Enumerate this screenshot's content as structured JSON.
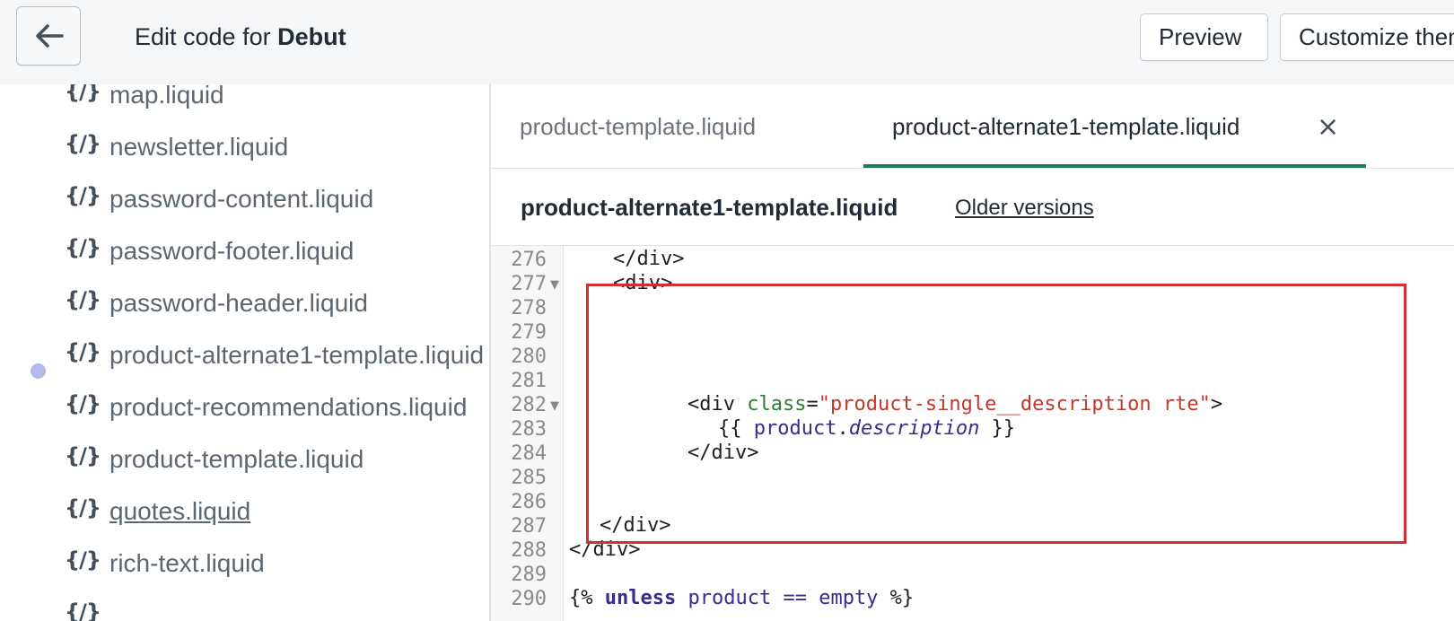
{
  "header": {
    "title_prefix": "Edit code for ",
    "theme_name": "Debut",
    "preview_label": "Preview",
    "customize_label": "Customize theme"
  },
  "sidebar": {
    "icon_glyph": "{/}",
    "items": [
      {
        "label": "map.liquid"
      },
      {
        "label": "newsletter.liquid"
      },
      {
        "label": "password-content.liquid"
      },
      {
        "label": "password-footer.liquid"
      },
      {
        "label": "password-header.liquid"
      },
      {
        "label": "product-alternate1-template.liquid",
        "modified": true
      },
      {
        "label": "product-recommendations.liquid"
      },
      {
        "label": "product-template.liquid"
      },
      {
        "label": " quotes.liquid",
        "underlined": true
      },
      {
        "label": "rich-text.liquid"
      }
    ]
  },
  "editor": {
    "tabs": [
      {
        "label": "product-template.liquid",
        "active": false
      },
      {
        "label": "product-alternate1-template.liquid",
        "active": true
      }
    ],
    "close_glyph": "×",
    "file_name": "product-alternate1-template.liquid",
    "older_versions_label": "Older versions",
    "line_numbers": [
      "276",
      "277",
      "278",
      "279",
      "280",
      "281",
      "282",
      "283",
      "284",
      "285",
      "286",
      "287",
      "288",
      "289",
      "290"
    ],
    "code": {
      "l276": "</div>",
      "l277": "<div>",
      "l282_open": "<div ",
      "l282_attr": "class",
      "l282_eq": "=",
      "l282_str": "\"product-single__description rte\"",
      "l282_close": ">",
      "l283_open": "{{ ",
      "l283_var": "product",
      "l283_dot": ".",
      "l283_prop": "description",
      "l283_close": " }}",
      "l284": "</div>",
      "l287": "</div>",
      "l288": "</div>",
      "l290_open": "{% ",
      "l290_kw": "unless",
      "l290_var": "product",
      "l290_op": "==",
      "l290_val": "empty",
      "l290_close": " %}"
    }
  },
  "colors": {
    "accent_green": "#1f7a5e",
    "highlight_red": "#d32f2f",
    "modified_dot": "#b3b8ed"
  }
}
